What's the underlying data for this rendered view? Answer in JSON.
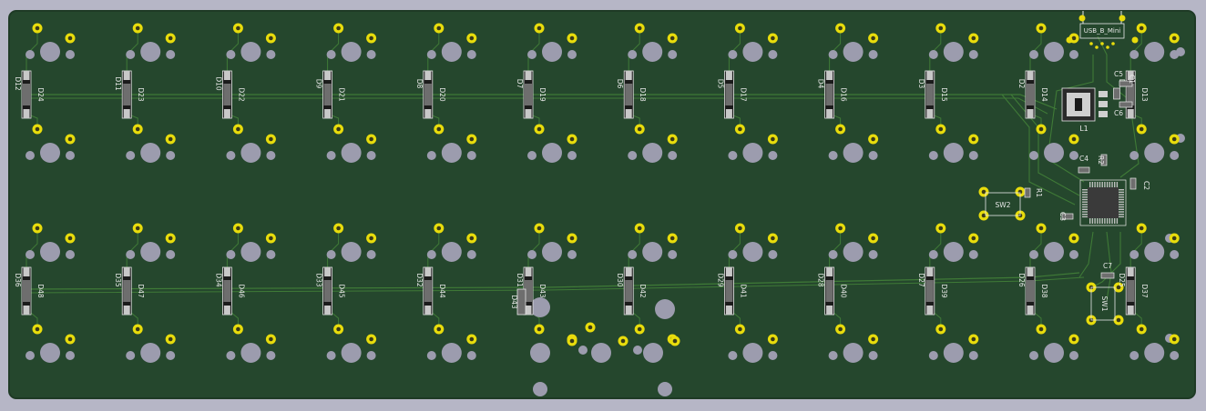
{
  "colors": {
    "background": "#b6b6c6",
    "board": "#25472d",
    "board_edge": "#1e3a25",
    "hole": "#9c9cae",
    "pad": "#e8dc0c",
    "pad_ring_dark": "#3a3a16",
    "trace": "#3f7a37",
    "silk": "#e8e8e8",
    "part_body": "#6e6e6e"
  },
  "pcb": {
    "connector_label": "USB_B_Mini",
    "top_diode_labels": [
      "D24",
      "D23",
      "D22",
      "D21",
      "D20",
      "D19",
      "D18",
      "D17",
      "D16",
      "D15",
      "D14",
      "D13"
    ],
    "top_diode_side_labels": [
      "D12",
      "D11",
      "D10",
      "D9",
      "D8",
      "D7",
      "D6",
      "D5",
      "D4",
      "D3",
      "D2",
      "D1"
    ],
    "bottom_diode_labels": [
      "D48",
      "D47",
      "D46",
      "D45",
      "D44",
      "D43",
      "D42",
      "D41",
      "D40",
      "D39",
      "D38",
      "D37"
    ],
    "bottom_diode_side_labels": [
      "D36",
      "D35",
      "D34",
      "D33",
      "D32",
      "D31",
      "D30",
      "D29",
      "D28",
      "D27",
      "D26",
      "D25"
    ],
    "extra_diode_label": "D43",
    "regulator_label": "L1",
    "switch_labels": [
      "SW1",
      "SW2"
    ],
    "cap_labels": [
      "C1",
      "C2",
      "C3",
      "C4",
      "C5",
      "C6",
      "C7"
    ],
    "resistor_labels": [
      "R1",
      "R2"
    ],
    "mcu_label": ""
  }
}
